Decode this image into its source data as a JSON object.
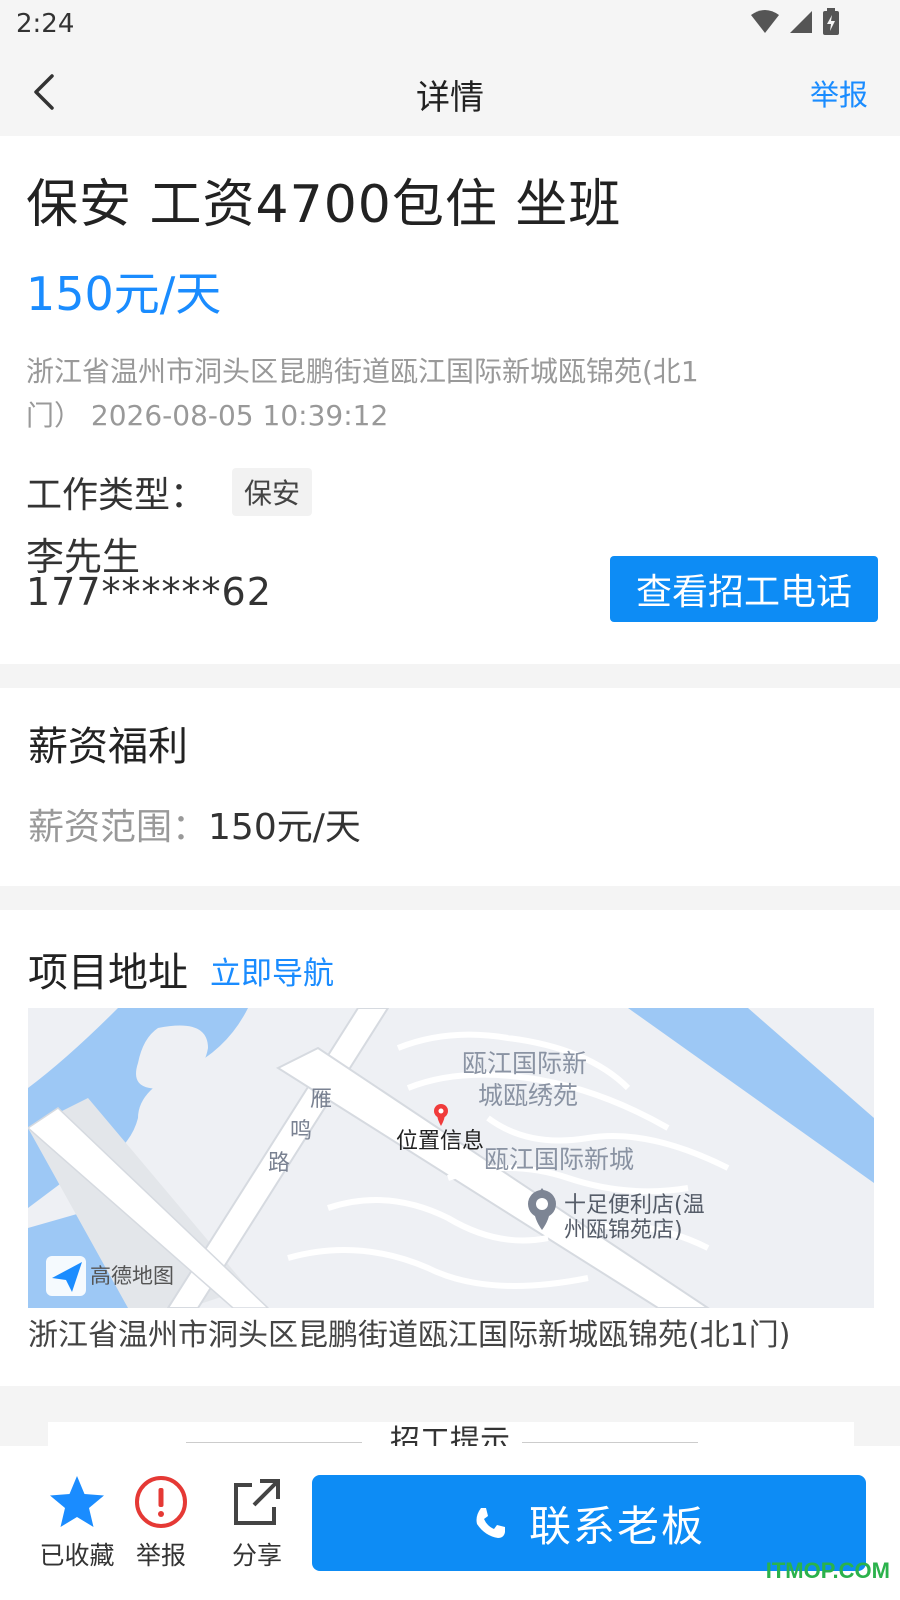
{
  "status_bar": {
    "time": "2:24"
  },
  "nav": {
    "title": "详情",
    "report_label": "举报"
  },
  "job": {
    "title": "保安 工资4700包住 坐班",
    "salary": "150元/天",
    "address_line1": "浙江省温州市洞头区昆鹏街道瓯江国际新城瓯锦苑(北1",
    "address_line2": "门）  2026-08-05 10:39:12",
    "type_label": "工作类型：",
    "type_tag": "保安",
    "contact_name": "李先生",
    "contact_phone": "177******62",
    "view_phone_button": "查看招工电话"
  },
  "salary_section": {
    "title": "薪资福利",
    "range_label": "薪资范围：",
    "range_value": "150元/天"
  },
  "address_section": {
    "title": "项目地址",
    "navigate_link": "立即导航",
    "map_labels": {
      "road": [
        "雁",
        "鸣",
        "路"
      ],
      "poi_area_line1": "瓯江国际新",
      "poi_area_line2": "城瓯绣苑",
      "marker_label": "位置信息",
      "district": "瓯江国际新城",
      "store_line1": "十足便利店(温",
      "store_line2": "州瓯锦苑店)",
      "logo_text": "高德地图"
    },
    "full_address": "浙江省温州市洞头区昆鹏街道瓯江国际新城瓯锦苑(北1门)"
  },
  "hint_section": {
    "title": "招工提示"
  },
  "bottom_bar": {
    "favorite_label": "已收藏",
    "report_label": "举报",
    "share_label": "分享",
    "contact_button": "联系老板"
  },
  "watermark": "ITMOP.COM",
  "colors": {
    "accent": "#1a8cff",
    "button": "#0d8cf5",
    "text": "#222222",
    "muted": "#999999"
  }
}
